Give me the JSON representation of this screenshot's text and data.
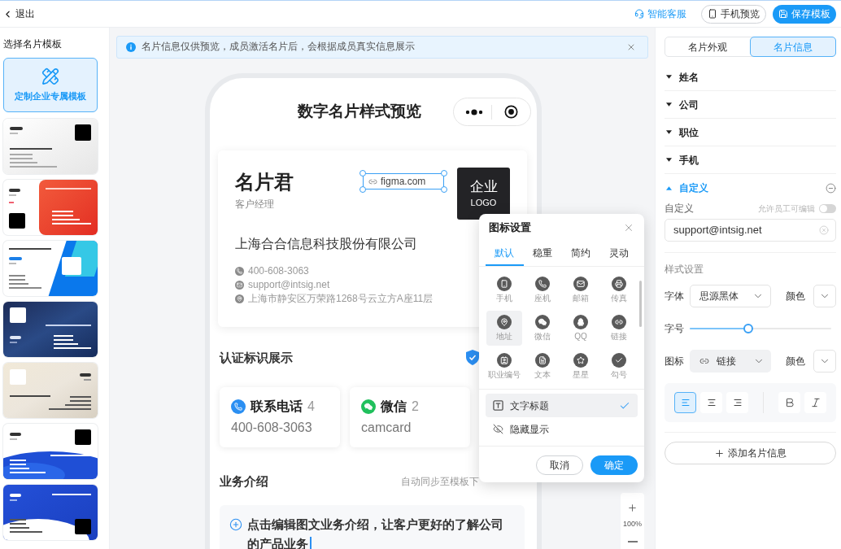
{
  "topbar": {
    "back": "退出",
    "actions": [
      {
        "kind": "service",
        "label": "智能客服"
      },
      {
        "kind": "preview",
        "label": "手机预览"
      },
      {
        "kind": "save",
        "label": "保存模板"
      }
    ]
  },
  "sidebar": {
    "title": "选择名片模板",
    "custom_template": "定制企业专属模板",
    "templates": [
      {
        "kind": "light"
      },
      {
        "kind": "red"
      },
      {
        "kind": "cyan"
      },
      {
        "kind": "navy"
      },
      {
        "kind": "beige"
      },
      {
        "kind": "wave"
      },
      {
        "kind": "banner"
      }
    ]
  },
  "notice": {
    "text": "名片信息仅供预览，成员激活名片后，会根据成员真实信息展示"
  },
  "preview": {
    "title": "数字名片样式预览",
    "card": {
      "name": "名片君",
      "position": "客户经理",
      "link": {
        "text": "figma.com",
        "selected": true
      },
      "logo_lines": [
        "企业",
        "LOGO"
      ],
      "company": "上海合合信息科技股份有限公司",
      "contacts": [
        {
          "kind": "landline",
          "text": "400-608-3063"
        },
        {
          "kind": "email",
          "text": "support@intsig.net"
        },
        {
          "kind": "address",
          "text": "上海市静安区万荣路1268号云立方A座11层"
        }
      ]
    },
    "certification": "认证标识展示",
    "stats": [
      {
        "kind": "landline",
        "label": "联系电话",
        "count": "4",
        "value": "400-608-3063"
      },
      {
        "kind": "wechat",
        "label": "微信",
        "count": "2",
        "value": "camcard"
      }
    ],
    "business": {
      "title": "业务介绍",
      "note": "自动同步至模板下",
      "text": "点击编辑图文业务介绍，让客户更好的了解公司的产品业务"
    },
    "zoom": "100%"
  },
  "icon_dialog": {
    "title": "图标设置",
    "tabs": [
      {
        "label": "默认",
        "selected": true
      },
      {
        "label": "稳重",
        "selected": false
      },
      {
        "label": "简约",
        "selected": false
      },
      {
        "label": "灵动",
        "selected": false
      }
    ],
    "icons": [
      {
        "kind": "mobile",
        "label": "手机",
        "selected": false
      },
      {
        "kind": "landline",
        "label": "座机",
        "selected": false
      },
      {
        "kind": "email",
        "label": "邮箱",
        "selected": false
      },
      {
        "kind": "fax",
        "label": "传真",
        "selected": false
      },
      {
        "kind": "address",
        "label": "地址",
        "selected": true
      },
      {
        "kind": "wechat",
        "label": "微信",
        "selected": false
      },
      {
        "kind": "qq",
        "label": "QQ",
        "selected": false
      },
      {
        "kind": "link",
        "label": "链接",
        "selected": false
      },
      {
        "kind": "license",
        "label": "职业编号",
        "selected": false
      },
      {
        "kind": "text",
        "label": "文本",
        "selected": false
      },
      {
        "kind": "star",
        "label": "星星",
        "selected": false
      },
      {
        "kind": "check",
        "label": "勾号",
        "selected": false
      }
    ],
    "options": [
      {
        "kind": "title",
        "label": "文字标题",
        "selected": true
      },
      {
        "kind": "hidden",
        "label": "隐藏显示",
        "selected": false
      }
    ],
    "buttons": [
      {
        "kind": "cancel",
        "label": "取消"
      },
      {
        "kind": "confirm",
        "label": "确定"
      }
    ]
  },
  "right_panel": {
    "tabs": [
      {
        "label": "名片外观",
        "selected": false
      },
      {
        "label": "名片信息",
        "selected": true
      }
    ],
    "fields": [
      {
        "label": "姓名",
        "expanded": false
      },
      {
        "label": "公司",
        "expanded": false
      },
      {
        "label": "职位",
        "expanded": false
      },
      {
        "label": "手机",
        "expanded": false
      },
      {
        "label": "自定义",
        "expanded": true
      }
    ],
    "custom": {
      "label": "自定义",
      "editable_label": "允许员工可编辑",
      "editable": false,
      "value": "support@intsig.net"
    },
    "style": {
      "title": "样式设置",
      "font_label": "字体",
      "font": "思源黑体",
      "font_color_label": "颜色",
      "size_label": "字号",
      "size": {
        "level": 0.41
      },
      "icon_label": "图标",
      "icon": {
        "kind": "link",
        "label": "链接"
      },
      "icon_color_label": "颜色",
      "align": [
        {
          "kind": "left",
          "selected": true
        },
        {
          "kind": "center",
          "selected": false
        },
        {
          "kind": "right",
          "selected": false
        }
      ],
      "format": [
        {
          "kind": "bold",
          "selected": false
        },
        {
          "kind": "italic",
          "selected": false
        }
      ]
    },
    "add_button": "添加名片信息"
  }
}
